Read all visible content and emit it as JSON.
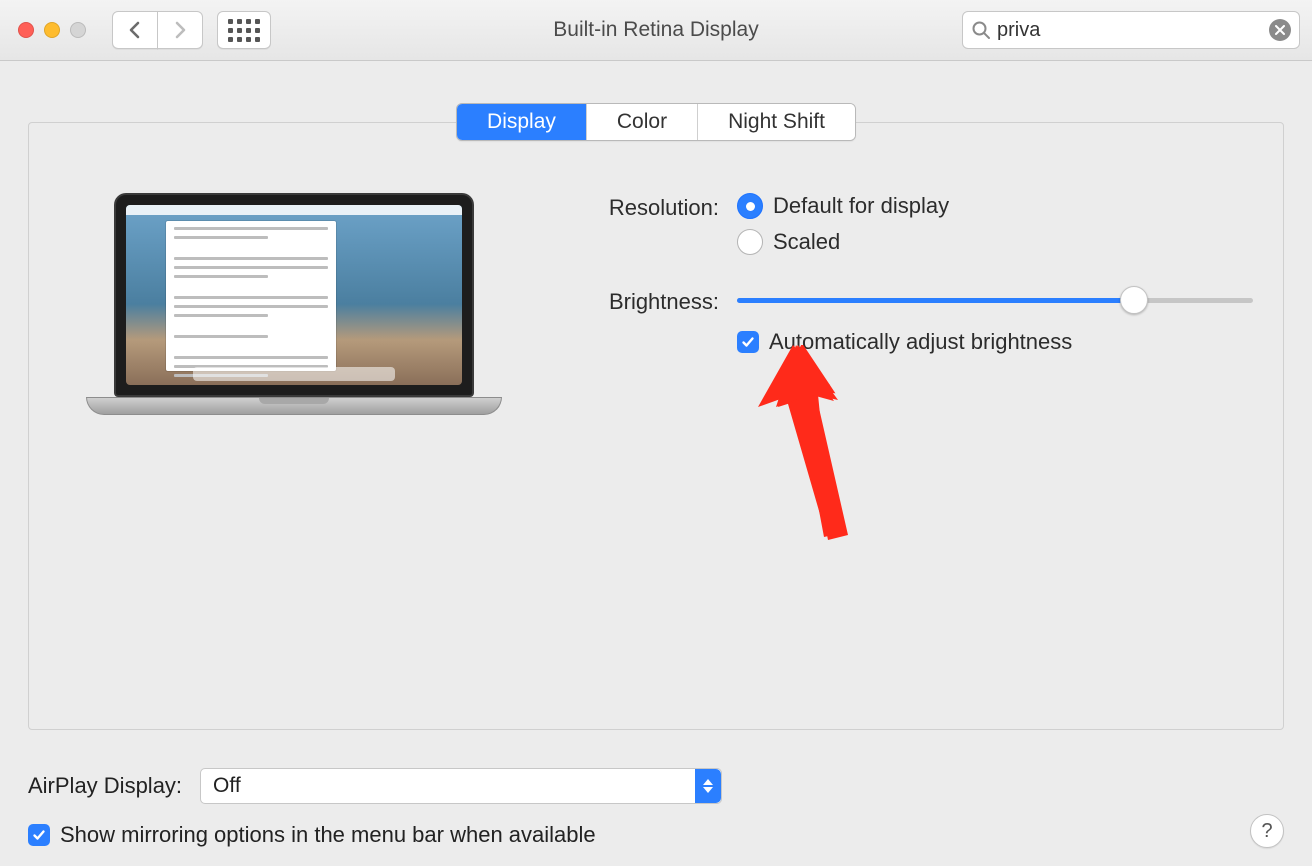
{
  "window_title": "Built-in Retina Display",
  "search": {
    "value": "priva"
  },
  "tabs": [
    "Display",
    "Color",
    "Night Shift"
  ],
  "active_tab": 0,
  "form": {
    "resolution_label": "Resolution:",
    "resolution_options": [
      "Default for display",
      "Scaled"
    ],
    "resolution_selected": 0,
    "brightness_label": "Brightness:",
    "brightness_percent": 77,
    "auto_brightness_label": "Automatically adjust brightness",
    "auto_brightness_checked": true
  },
  "airplay": {
    "label": "AirPlay Display:",
    "value": "Off"
  },
  "mirroring": {
    "label": "Show mirroring options in the menu bar when available",
    "checked": true
  },
  "help_label": "?"
}
